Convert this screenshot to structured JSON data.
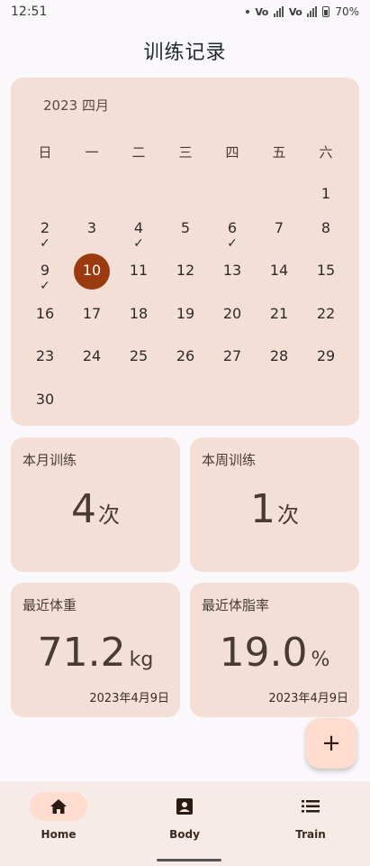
{
  "status_bar": {
    "time": "12:51",
    "net1": "Vo",
    "net2": "Vo",
    "battery": "70%"
  },
  "title": "训练记录",
  "calendar": {
    "month_label": "2023 四月",
    "weekdays": [
      "日",
      "一",
      "二",
      "三",
      "四",
      "五",
      "六"
    ],
    "days": [
      {
        "d": "1",
        "col": 6,
        "row": 0,
        "checked": false
      },
      {
        "d": "2",
        "col": 0,
        "row": 1,
        "checked": true
      },
      {
        "d": "3",
        "col": 1,
        "row": 1,
        "checked": false
      },
      {
        "d": "4",
        "col": 2,
        "row": 1,
        "checked": true
      },
      {
        "d": "5",
        "col": 3,
        "row": 1,
        "checked": false
      },
      {
        "d": "6",
        "col": 4,
        "row": 1,
        "checked": true
      },
      {
        "d": "7",
        "col": 5,
        "row": 1,
        "checked": false
      },
      {
        "d": "8",
        "col": 6,
        "row": 1,
        "checked": false
      },
      {
        "d": "9",
        "col": 0,
        "row": 2,
        "checked": true
      },
      {
        "d": "10",
        "col": 1,
        "row": 2,
        "checked": false,
        "today": true
      },
      {
        "d": "11",
        "col": 2,
        "row": 2,
        "checked": false
      },
      {
        "d": "12",
        "col": 3,
        "row": 2,
        "checked": false
      },
      {
        "d": "13",
        "col": 4,
        "row": 2,
        "checked": false
      },
      {
        "d": "14",
        "col": 5,
        "row": 2,
        "checked": false
      },
      {
        "d": "15",
        "col": 6,
        "row": 2,
        "checked": false
      },
      {
        "d": "16",
        "col": 0,
        "row": 3,
        "checked": false
      },
      {
        "d": "17",
        "col": 1,
        "row": 3,
        "checked": false
      },
      {
        "d": "18",
        "col": 2,
        "row": 3,
        "checked": false
      },
      {
        "d": "19",
        "col": 3,
        "row": 3,
        "checked": false
      },
      {
        "d": "20",
        "col": 4,
        "row": 3,
        "checked": false
      },
      {
        "d": "21",
        "col": 5,
        "row": 3,
        "checked": false
      },
      {
        "d": "22",
        "col": 6,
        "row": 3,
        "checked": false
      },
      {
        "d": "23",
        "col": 0,
        "row": 4,
        "checked": false
      },
      {
        "d": "24",
        "col": 1,
        "row": 4,
        "checked": false
      },
      {
        "d": "25",
        "col": 2,
        "row": 4,
        "checked": false
      },
      {
        "d": "26",
        "col": 3,
        "row": 4,
        "checked": false
      },
      {
        "d": "27",
        "col": 4,
        "row": 4,
        "checked": false
      },
      {
        "d": "28",
        "col": 5,
        "row": 4,
        "checked": false
      },
      {
        "d": "29",
        "col": 6,
        "row": 4,
        "checked": false
      },
      {
        "d": "30",
        "col": 0,
        "row": 5,
        "checked": false
      }
    ],
    "check_mark": "✓"
  },
  "stats": {
    "month_label": "本月训练",
    "month_value": "4",
    "month_unit": "次",
    "week_label": "本周训练",
    "week_value": "1",
    "week_unit": "次",
    "weight_label": "最近体重",
    "weight_value": "71.2",
    "weight_unit": "kg",
    "weight_date": "2023年4月9日",
    "fat_label": "最近体脂率",
    "fat_value": "19.0",
    "fat_unit": "%",
    "fat_date": "2023年4月9日"
  },
  "fab": {
    "label": "+"
  },
  "nav": {
    "items": [
      {
        "label": "Home",
        "icon": "home-icon",
        "active": true
      },
      {
        "label": "Body",
        "icon": "person-box-icon",
        "active": false
      },
      {
        "label": "Train",
        "icon": "list-icon",
        "active": false
      }
    ]
  },
  "colors": {
    "card": "#F4DFD6",
    "today": "#9A3A0E",
    "accent": "#FFDCCD",
    "nav_bg": "#F6EBE6"
  }
}
